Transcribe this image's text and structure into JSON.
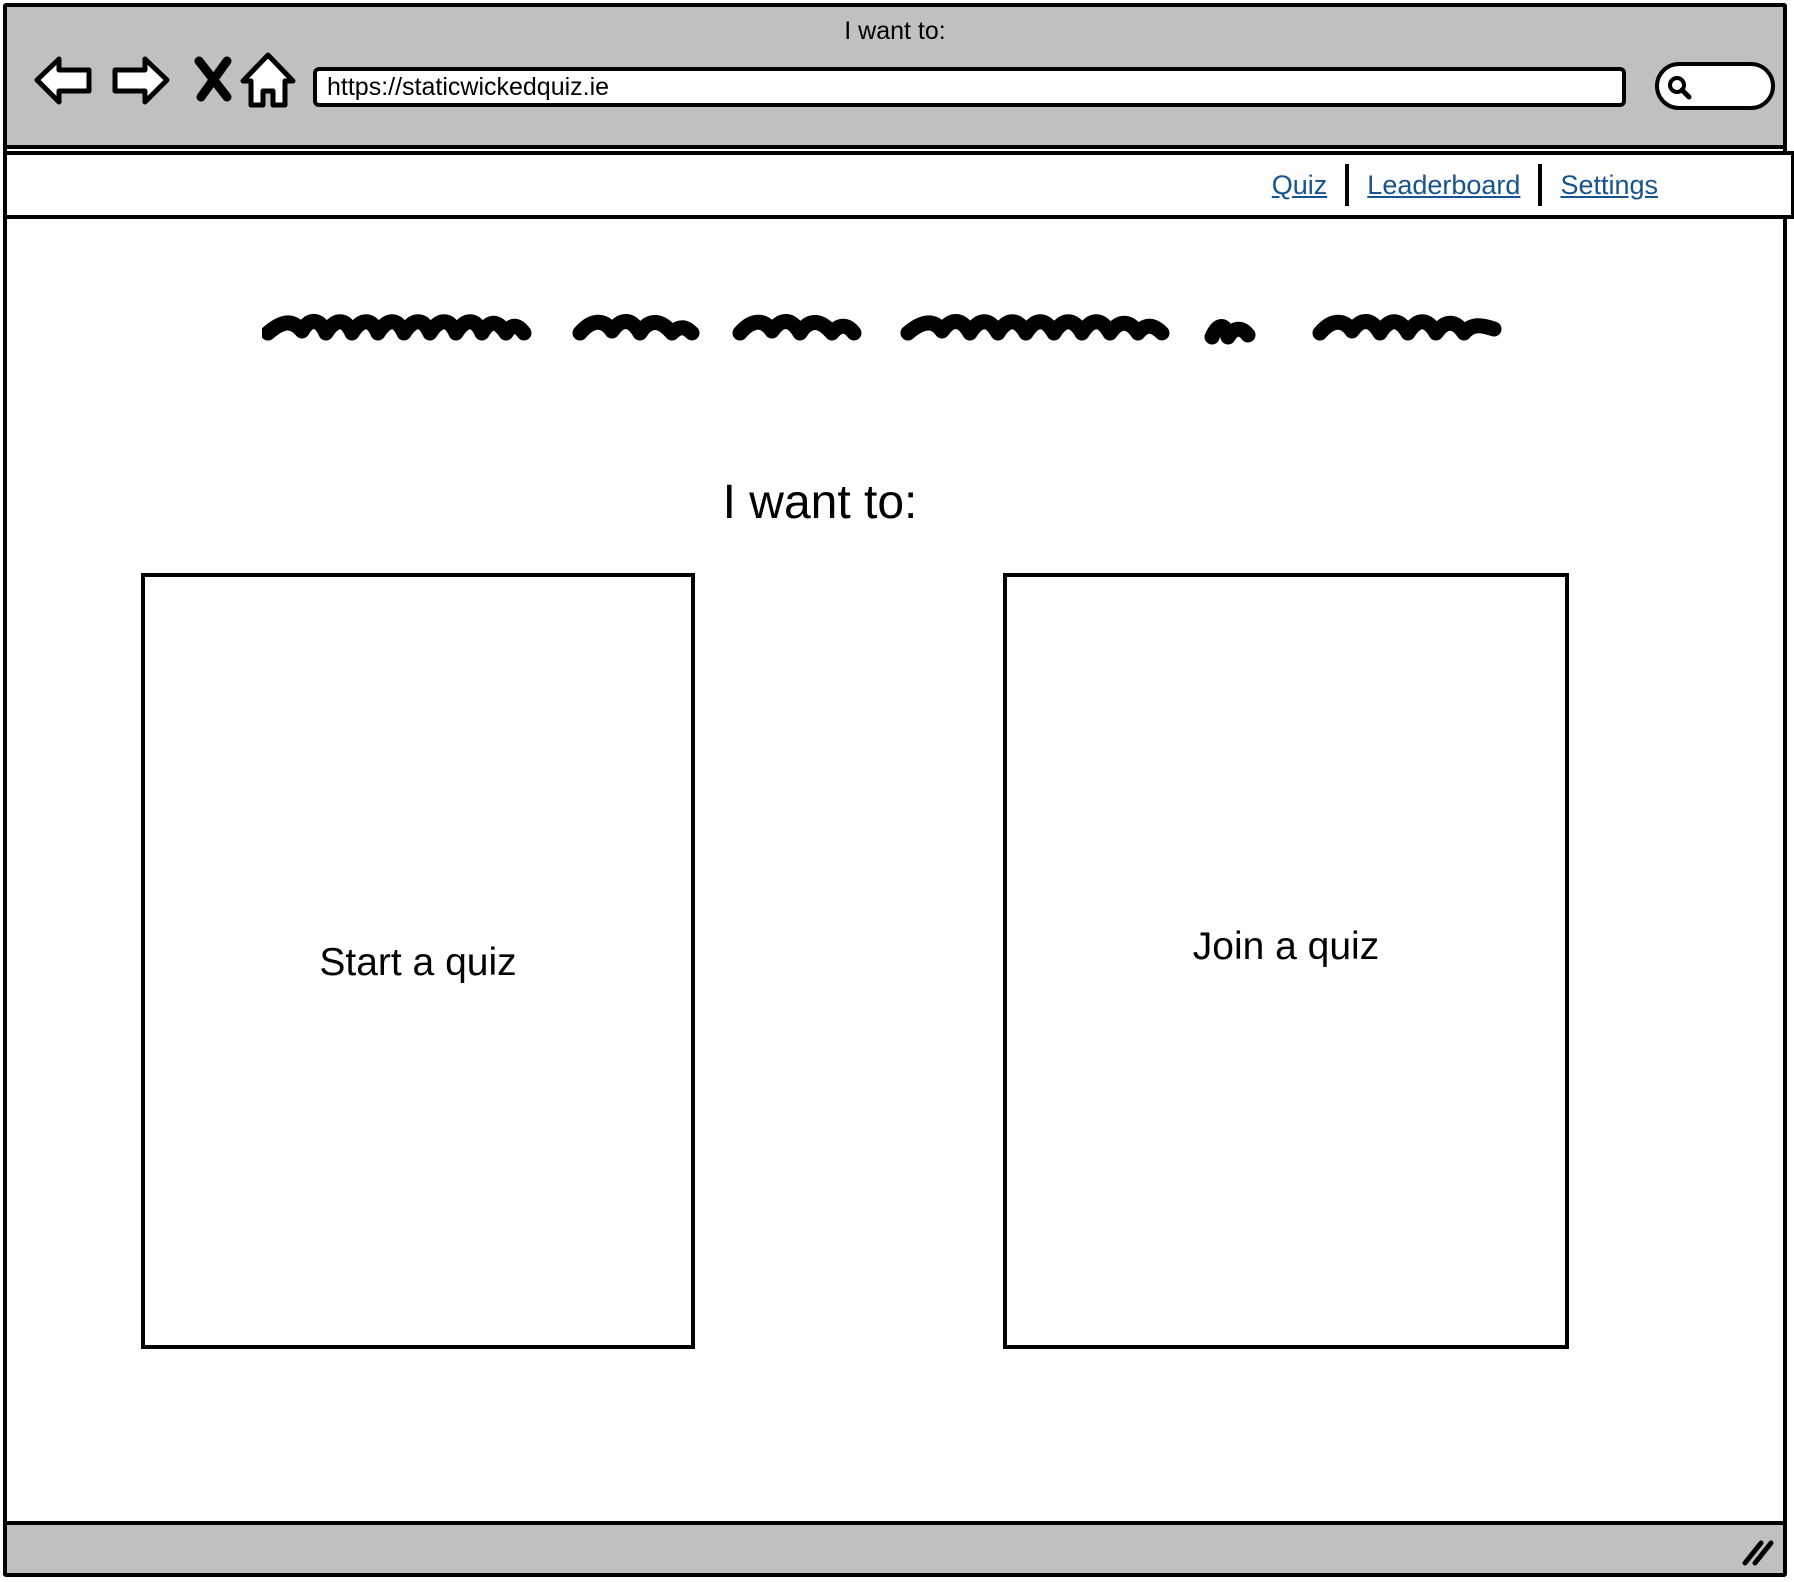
{
  "window": {
    "title": "I want to:"
  },
  "browser": {
    "url": "https://staticwickedquiz.ie",
    "icons": [
      "back-arrow-icon",
      "forward-arrow-icon",
      "stop-icon",
      "home-icon",
      "search-icon",
      "resize-handle-icon"
    ]
  },
  "nav": {
    "items": [
      {
        "label": "Quiz"
      },
      {
        "label": "Leaderboard"
      },
      {
        "label": "Settings"
      }
    ],
    "link_color": "#17548f"
  },
  "main": {
    "heading": "I want to:",
    "cards": [
      {
        "label": "Start a quiz"
      },
      {
        "label": "Join a quiz"
      }
    ]
  },
  "colors": {
    "chrome": "#c0c0c0",
    "border": "#000000",
    "background": "#ffffff"
  }
}
